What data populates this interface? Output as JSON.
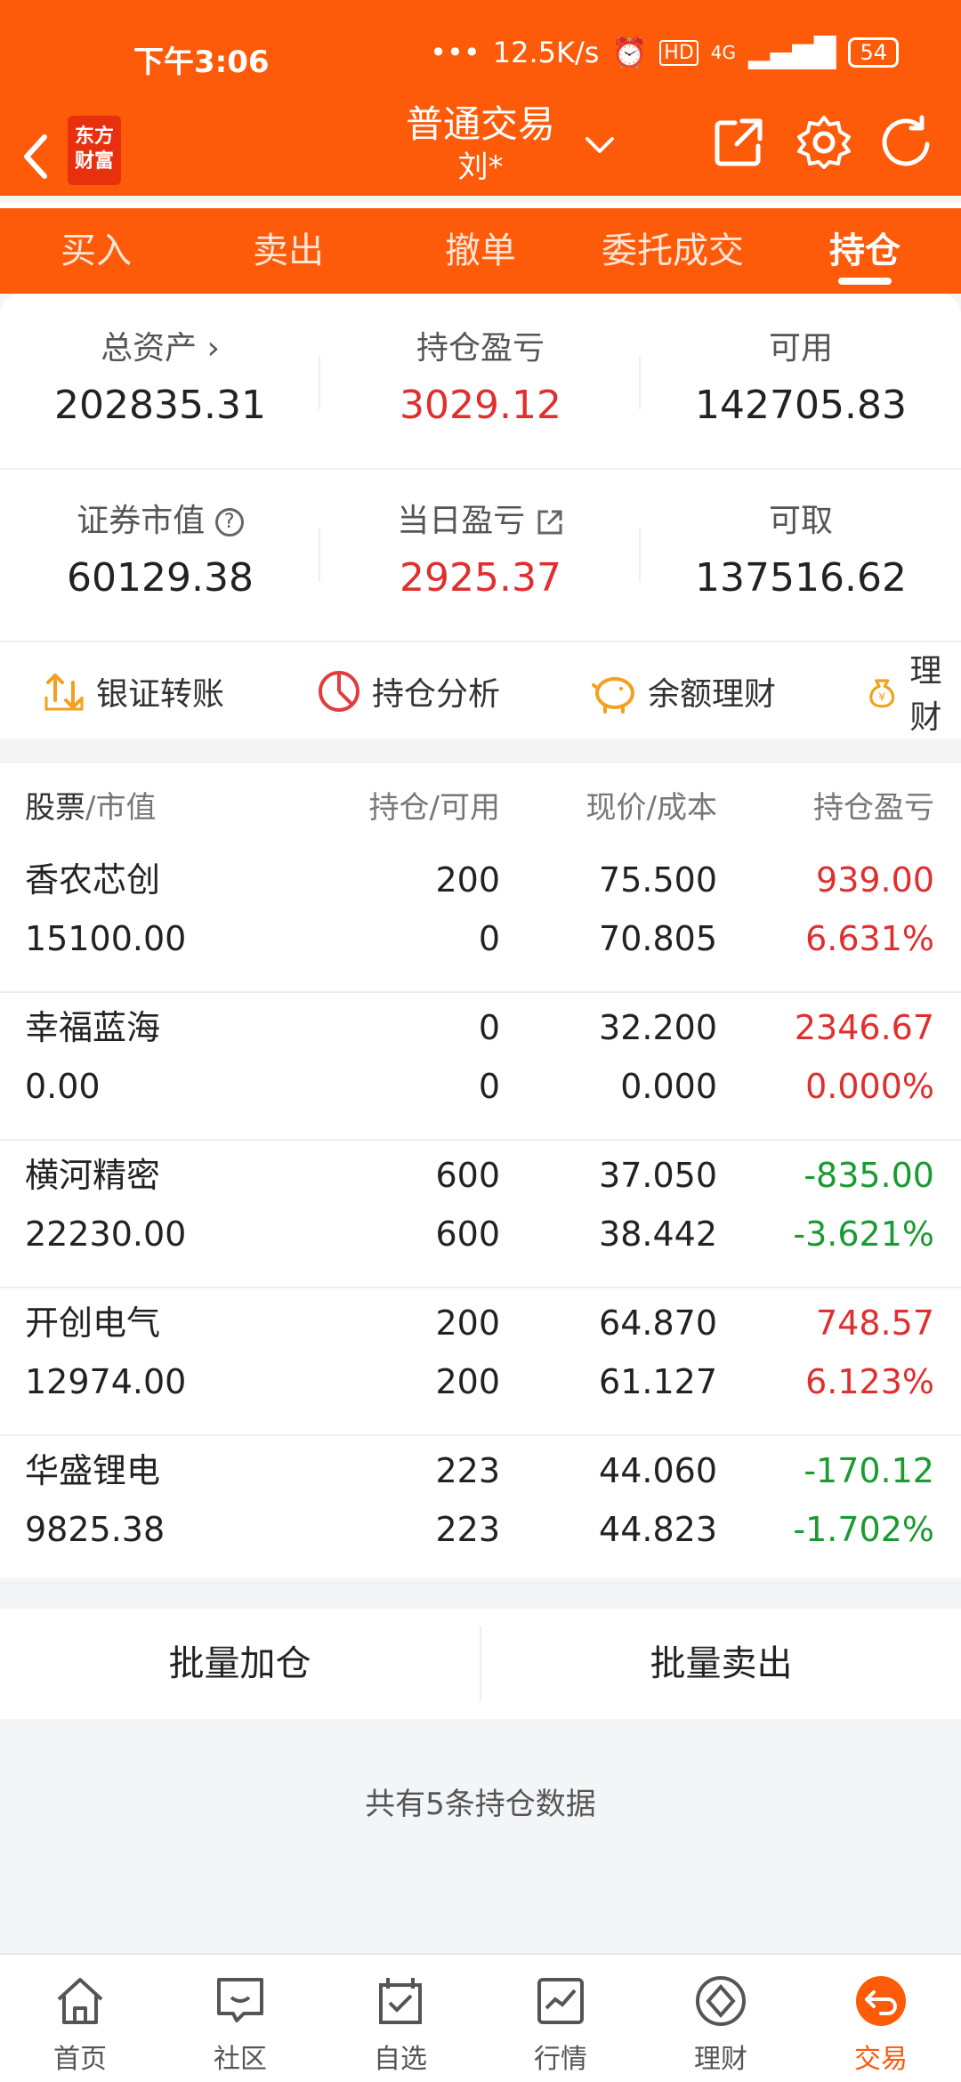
{
  "status": {
    "time": "下午3:06",
    "speed": "12.5K/s",
    "net": "4G",
    "battery": "54"
  },
  "appbar": {
    "logo_line1": "东方",
    "logo_line2": "财富",
    "title": "普通交易",
    "subtitle": "刘*"
  },
  "tabs": [
    "买入",
    "卖出",
    "撤单",
    "委托成交",
    "持仓"
  ],
  "summary": {
    "total_assets_label": "总资产",
    "total_assets": "202835.31",
    "pos_pl_label": "持仓盈亏",
    "pos_pl": "3029.12",
    "available_label": "可用",
    "available": "142705.83",
    "market_value_label": "证券市值",
    "market_value": "60129.38",
    "day_pl_label": "当日盈亏",
    "day_pl": "2925.37",
    "withdrawable_label": "可取",
    "withdrawable": "137516.62"
  },
  "shortcuts": {
    "transfer": "银证转账",
    "analysis": "持仓分析",
    "balance_finance": "余额理财",
    "finance": "理财"
  },
  "table": {
    "h_stock": "股票",
    "h_value": "/市值",
    "h_pos": "持仓/可用",
    "h_price": "现价/成本",
    "h_pl": "持仓盈亏",
    "rows": [
      {
        "name": "香农芯创",
        "mv": "15100.00",
        "pos": "200",
        "avail": "0",
        "price": "75.500",
        "cost": "70.805",
        "pl": "939.00",
        "pct": "6.631%",
        "color": "red"
      },
      {
        "name": "幸福蓝海",
        "mv": "0.00",
        "pos": "0",
        "avail": "0",
        "price": "32.200",
        "cost": "0.000",
        "pl": "2346.67",
        "pct": "0.000%",
        "color": "red"
      },
      {
        "name": "横河精密",
        "mv": "22230.00",
        "pos": "600",
        "avail": "600",
        "price": "37.050",
        "cost": "38.442",
        "pl": "-835.00",
        "pct": "-3.621%",
        "color": "green"
      },
      {
        "name": "开创电气",
        "mv": "12974.00",
        "pos": "200",
        "avail": "200",
        "price": "64.870",
        "cost": "61.127",
        "pl": "748.57",
        "pct": "6.123%",
        "color": "red"
      },
      {
        "name": "华盛锂电",
        "mv": "9825.38",
        "pos": "223",
        "avail": "223",
        "price": "44.060",
        "cost": "44.823",
        "pl": "-170.12",
        "pct": "-1.702%",
        "color": "green"
      }
    ]
  },
  "batch": {
    "add": "批量加仓",
    "sell": "批量卖出"
  },
  "count_text": "共有5条持仓数据",
  "bottom_nav": [
    "首页",
    "社区",
    "自选",
    "行情",
    "理财",
    "交易"
  ],
  "colors": {
    "brand": "#fd5a0a",
    "up": "#e02f2f",
    "down": "#1a9b32"
  }
}
